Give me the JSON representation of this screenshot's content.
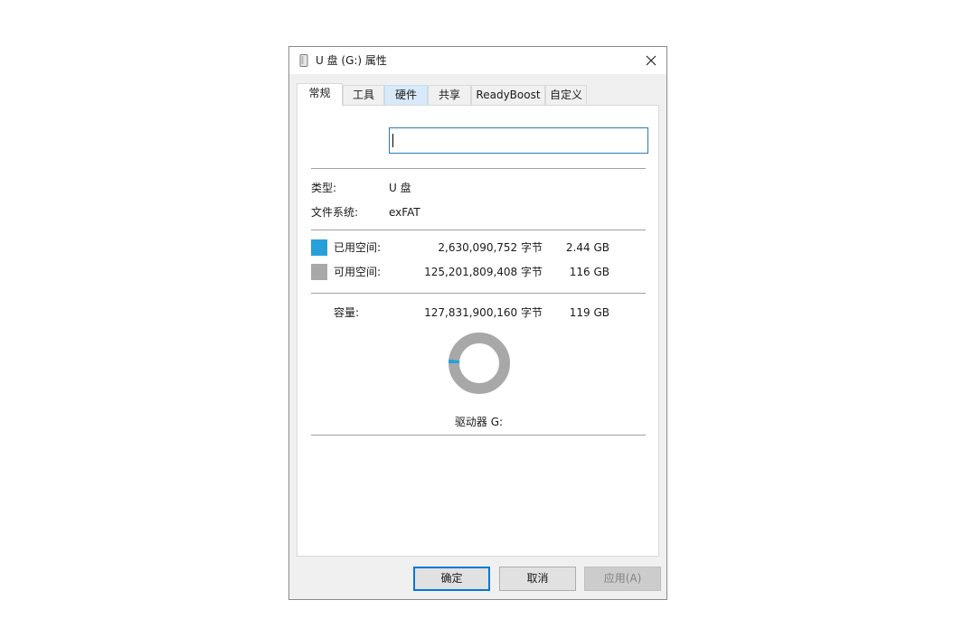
{
  "window": {
    "title": "U 盘 (G:) 属性",
    "close_glyph": "✕"
  },
  "tabs": [
    {
      "label": "常规",
      "active": true
    },
    {
      "label": "工具",
      "active": false
    },
    {
      "label": "硬件",
      "active": false
    },
    {
      "label": "共享",
      "active": false
    },
    {
      "label": "ReadyBoost",
      "active": false
    },
    {
      "label": "自定义",
      "active": false
    }
  ],
  "general": {
    "volume_name": "",
    "type_label": "类型:",
    "type_value": "U 盘",
    "fs_label": "文件系统:",
    "fs_value": "exFAT",
    "used_label": "已用空间:",
    "used_bytes": "2,630,090,752 字节",
    "used_size": "2.44 GB",
    "free_label": "可用空间:",
    "free_bytes": "125,201,809,408 字节",
    "free_size": "116 GB",
    "capacity_label": "容量:",
    "capacity_bytes": "127,831,900,160 字节",
    "capacity_size": "119 GB",
    "drive_label": "驱动器 G:"
  },
  "usage": {
    "used_fraction": 0.0206,
    "used_color": "#26a0da",
    "free_color": "#a8a8a8"
  },
  "buttons": {
    "ok": "确定",
    "cancel": "取消",
    "apply": "应用(A)"
  }
}
